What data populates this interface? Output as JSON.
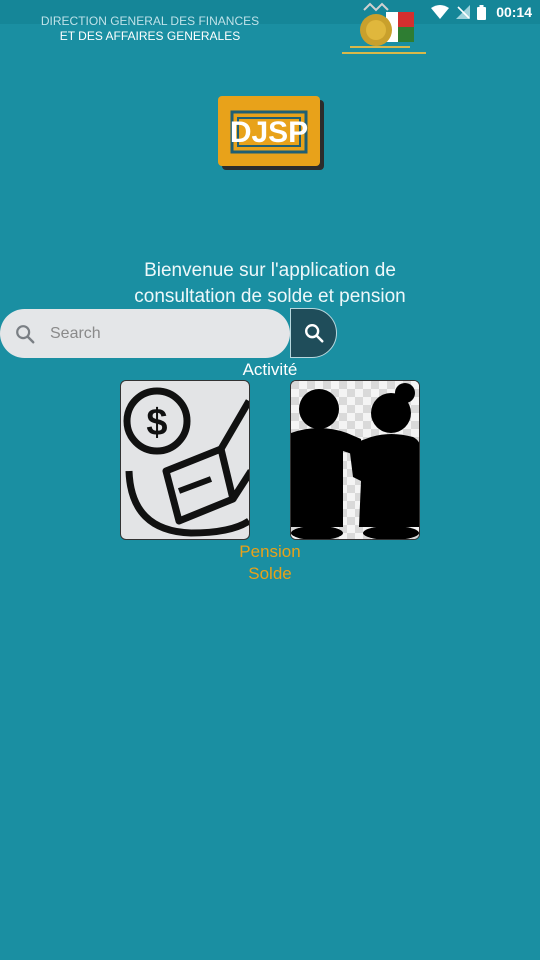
{
  "status_bar": {
    "time": "00:14"
  },
  "header": {
    "department_line1": "DIRECTION GENERAL DES FINANCES",
    "department_line2": "ET DES AFFAIRES GENERALES"
  },
  "logo": {
    "text": "DJSP"
  },
  "welcome": {
    "line1": "Bienvenue sur l'application de",
    "line2": "consultation de solde et pension"
  },
  "search": {
    "placeholder": "Search"
  },
  "section_label": "Activité",
  "tiles": {
    "pension_label": "Pension",
    "solde_label": "Solde"
  },
  "colors": {
    "background": "#1a8fa2",
    "accent": "#e8a21a",
    "search_button": "#1f4d5a"
  }
}
